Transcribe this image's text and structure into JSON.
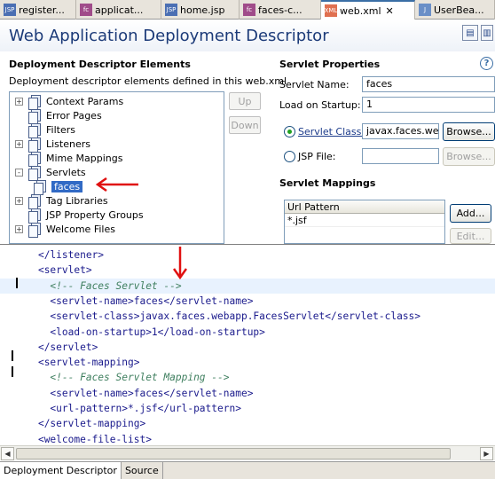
{
  "editor_tabs": [
    {
      "label": "register...",
      "icon": "jsp-file-icon",
      "active": false
    },
    {
      "label": "applicat...",
      "icon": "faces-config-icon",
      "active": false
    },
    {
      "label": "home.jsp",
      "icon": "jsp-file-icon",
      "active": false
    },
    {
      "label": "faces-c...",
      "icon": "faces-config-icon",
      "active": false
    },
    {
      "label": "web.xml",
      "icon": "xml-file-icon",
      "active": true
    },
    {
      "label": "UserBea...",
      "icon": "java-file-icon",
      "active": false
    }
  ],
  "header": {
    "title": "Web Application Deployment Descriptor"
  },
  "elements_section": {
    "title": "Deployment Descriptor Elements",
    "description": "Deployment descriptor elements defined in this web.xml",
    "tree": [
      {
        "label": "Context Params",
        "expander": "+"
      },
      {
        "label": "Error Pages",
        "expander": ""
      },
      {
        "label": "Filters",
        "expander": ""
      },
      {
        "label": "Listeners",
        "expander": "+"
      },
      {
        "label": "Mime Mappings",
        "expander": ""
      },
      {
        "label": "Servlets",
        "expander": "-"
      },
      {
        "label": "faces",
        "expander": "",
        "child": true,
        "selected": true
      },
      {
        "label": "Tag Libraries",
        "expander": "+"
      },
      {
        "label": "JSP Property Groups",
        "expander": ""
      },
      {
        "label": "Welcome Files",
        "expander": "+"
      }
    ],
    "up_label": "Up",
    "down_label": "Down"
  },
  "servlet_properties": {
    "title": "Servlet Properties",
    "servlet_name_label": "Servlet Name:",
    "servlet_name_value": "faces",
    "load_on_startup_label": "Load on Startup:",
    "load_on_startup_value": "1",
    "servlet_class_label": "Servlet Class:",
    "servlet_class_value": "javax.faces.web",
    "browse_label": "Browse...",
    "jsp_file_label": "JSP File:",
    "jsp_file_value": "",
    "browse2_label": "Browse..."
  },
  "servlet_mappings": {
    "title": "Servlet Mappings",
    "column_header": "Url Pattern",
    "rows": [
      "*.jsf"
    ],
    "add_label": "Add...",
    "edit_label": "Edit..."
  },
  "source_lines": [
    {
      "indent": "    ",
      "text": "</listener>",
      "kind": "tag"
    },
    {
      "indent": "    ",
      "text": "<servlet>",
      "kind": "tag"
    },
    {
      "indent": "      ",
      "text": "<!-- Faces Servlet -->",
      "kind": "comment",
      "current": true
    },
    {
      "indent": "      ",
      "text": "<servlet-name>faces</servlet-name>",
      "kind": "tag"
    },
    {
      "indent": "      ",
      "text": "<servlet-class>javax.faces.webapp.FacesServlet</servlet-class>",
      "kind": "tag"
    },
    {
      "indent": "      ",
      "text": "<load-on-startup>1</load-on-startup>",
      "kind": "tag"
    },
    {
      "indent": "    ",
      "text": "</servlet>",
      "kind": "tag"
    },
    {
      "indent": "    ",
      "text": "<servlet-mapping>",
      "kind": "tag"
    },
    {
      "indent": "      ",
      "text": "<!-- Faces Servlet Mapping -->",
      "kind": "comment"
    },
    {
      "indent": "      ",
      "text": "<servlet-name>faces</servlet-name>",
      "kind": "tag"
    },
    {
      "indent": "      ",
      "text": "<url-pattern>*.jsf</url-pattern>",
      "kind": "tag"
    },
    {
      "indent": "    ",
      "text": "</servlet-mapping>",
      "kind": "tag"
    },
    {
      "indent": "    ",
      "text": "<welcome-file-list>",
      "kind": "tag"
    }
  ],
  "bottom_tabs": [
    {
      "label": "Deployment Descriptor",
      "active": true
    },
    {
      "label": "Source",
      "active": false
    }
  ],
  "colors": {
    "title_blue": "#1b3a78",
    "selection": "#316ac5",
    "annotation_arrow": "#e01010",
    "comment_green": "#3f7f5f"
  }
}
